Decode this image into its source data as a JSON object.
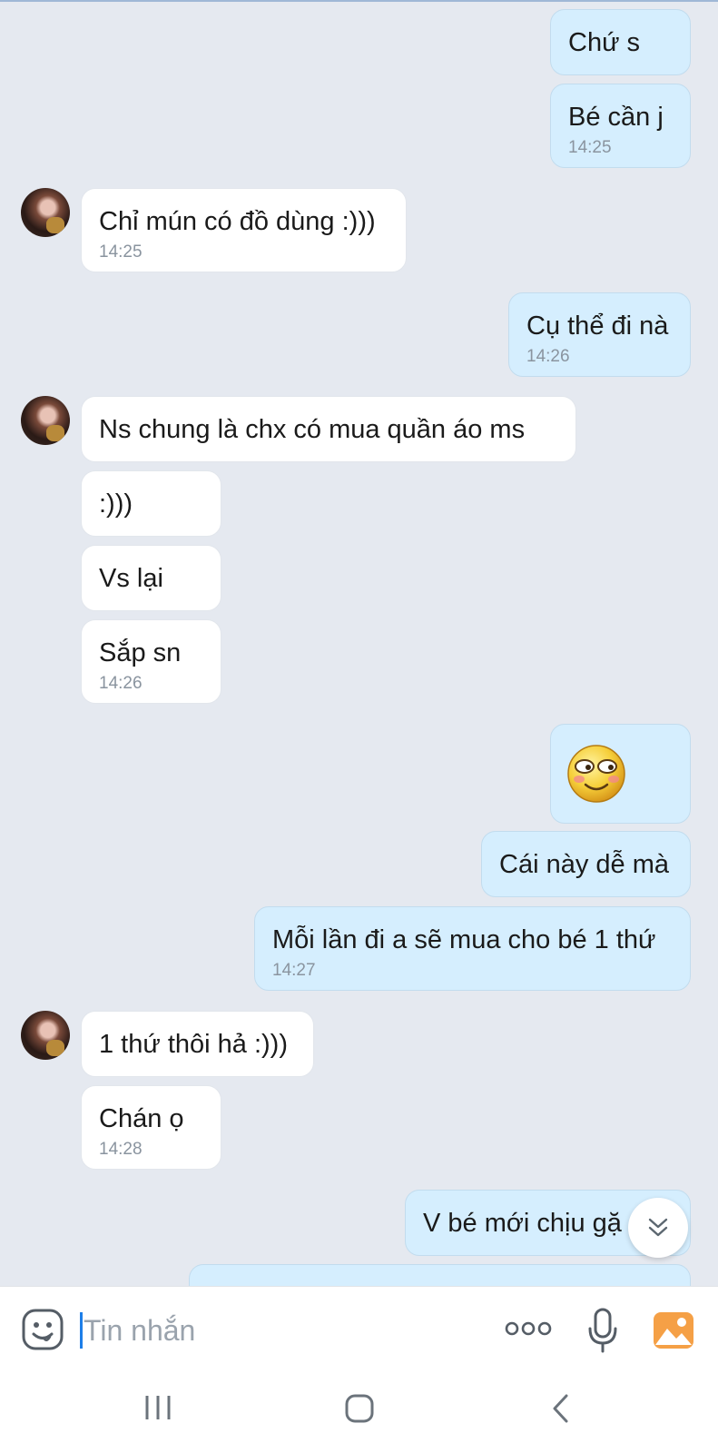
{
  "messages": [
    {
      "from": "me",
      "text": "Chứ s",
      "time": ""
    },
    {
      "from": "me",
      "text": "Bé cần j",
      "time": "14:25"
    },
    {
      "from": "them",
      "text": "Chỉ mún có đồ dùng :)))",
      "time": "14:25"
    },
    {
      "from": "me",
      "text": "Cụ thể đi nà",
      "time": "14:26"
    },
    {
      "from": "them",
      "text": "Ns chung là chx có mua quần áo ms",
      "time": ""
    },
    {
      "from": "them",
      "text": ":)))",
      "time": ""
    },
    {
      "from": "them",
      "text": "Vs lại",
      "time": ""
    },
    {
      "from": "them",
      "text": "Sắp sn",
      "time": "14:26"
    },
    {
      "from": "me",
      "text": "",
      "sticker": "shy-smile-emoji",
      "time": ""
    },
    {
      "from": "me",
      "text": "Cái này dễ mà",
      "time": ""
    },
    {
      "from": "me",
      "text": "Mỗi lần đi a sẽ mua cho bé 1 thứ",
      "time": "14:27"
    },
    {
      "from": "them",
      "text": "1 thứ thôi hả :)))",
      "time": ""
    },
    {
      "from": "them",
      "text": "Chán ọ",
      "time": "14:28"
    },
    {
      "from": "me",
      "text": "V bé mới chịu gặ",
      "time": ""
    }
  ],
  "input": {
    "placeholder": "Tin nhắn"
  },
  "icons": {
    "sticker": "sticker-icon",
    "more": "more-options-icon",
    "mic": "microphone-icon",
    "gallery": "gallery-icon",
    "scroll": "scroll-down-icon",
    "nav_recent": "recent-apps-icon",
    "nav_home": "home-icon",
    "nav_back": "back-icon"
  },
  "colors": {
    "my_bubble": "#d5eefe",
    "their_bubble": "#ffffff",
    "background": "#e5e9f0",
    "accent": "#1d7ee8",
    "gallery": "#f5a046"
  }
}
